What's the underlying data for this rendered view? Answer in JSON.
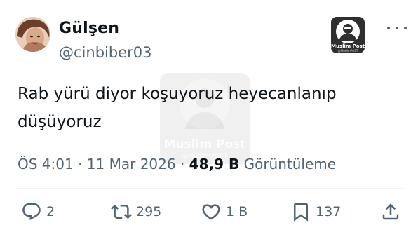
{
  "author": {
    "display_name": "Gülşen",
    "handle": "@cinbiber03"
  },
  "watermark": {
    "title": "Muslim Post",
    "subtitle": "@MuslimPOST"
  },
  "tweet": {
    "text": "Rab yürü diyor koşuyoruz heyecanlanıp düşüyoruz",
    "time": "ÖS 4:01",
    "date": "11 Mar 2026",
    "separator": "·",
    "views_count": "48,9 B",
    "views_label": "Görüntüleme"
  },
  "actions": {
    "reply_count": "2",
    "retweet_count": "295",
    "like_count": "1 B",
    "bookmark_count": "137"
  },
  "colors": {
    "text_primary": "#0f1419",
    "text_secondary": "#536471",
    "icon": "#536471"
  },
  "icons": [
    "more-icon",
    "reply-icon",
    "retweet-icon",
    "like-icon",
    "bookmark-icon",
    "share-icon"
  ]
}
